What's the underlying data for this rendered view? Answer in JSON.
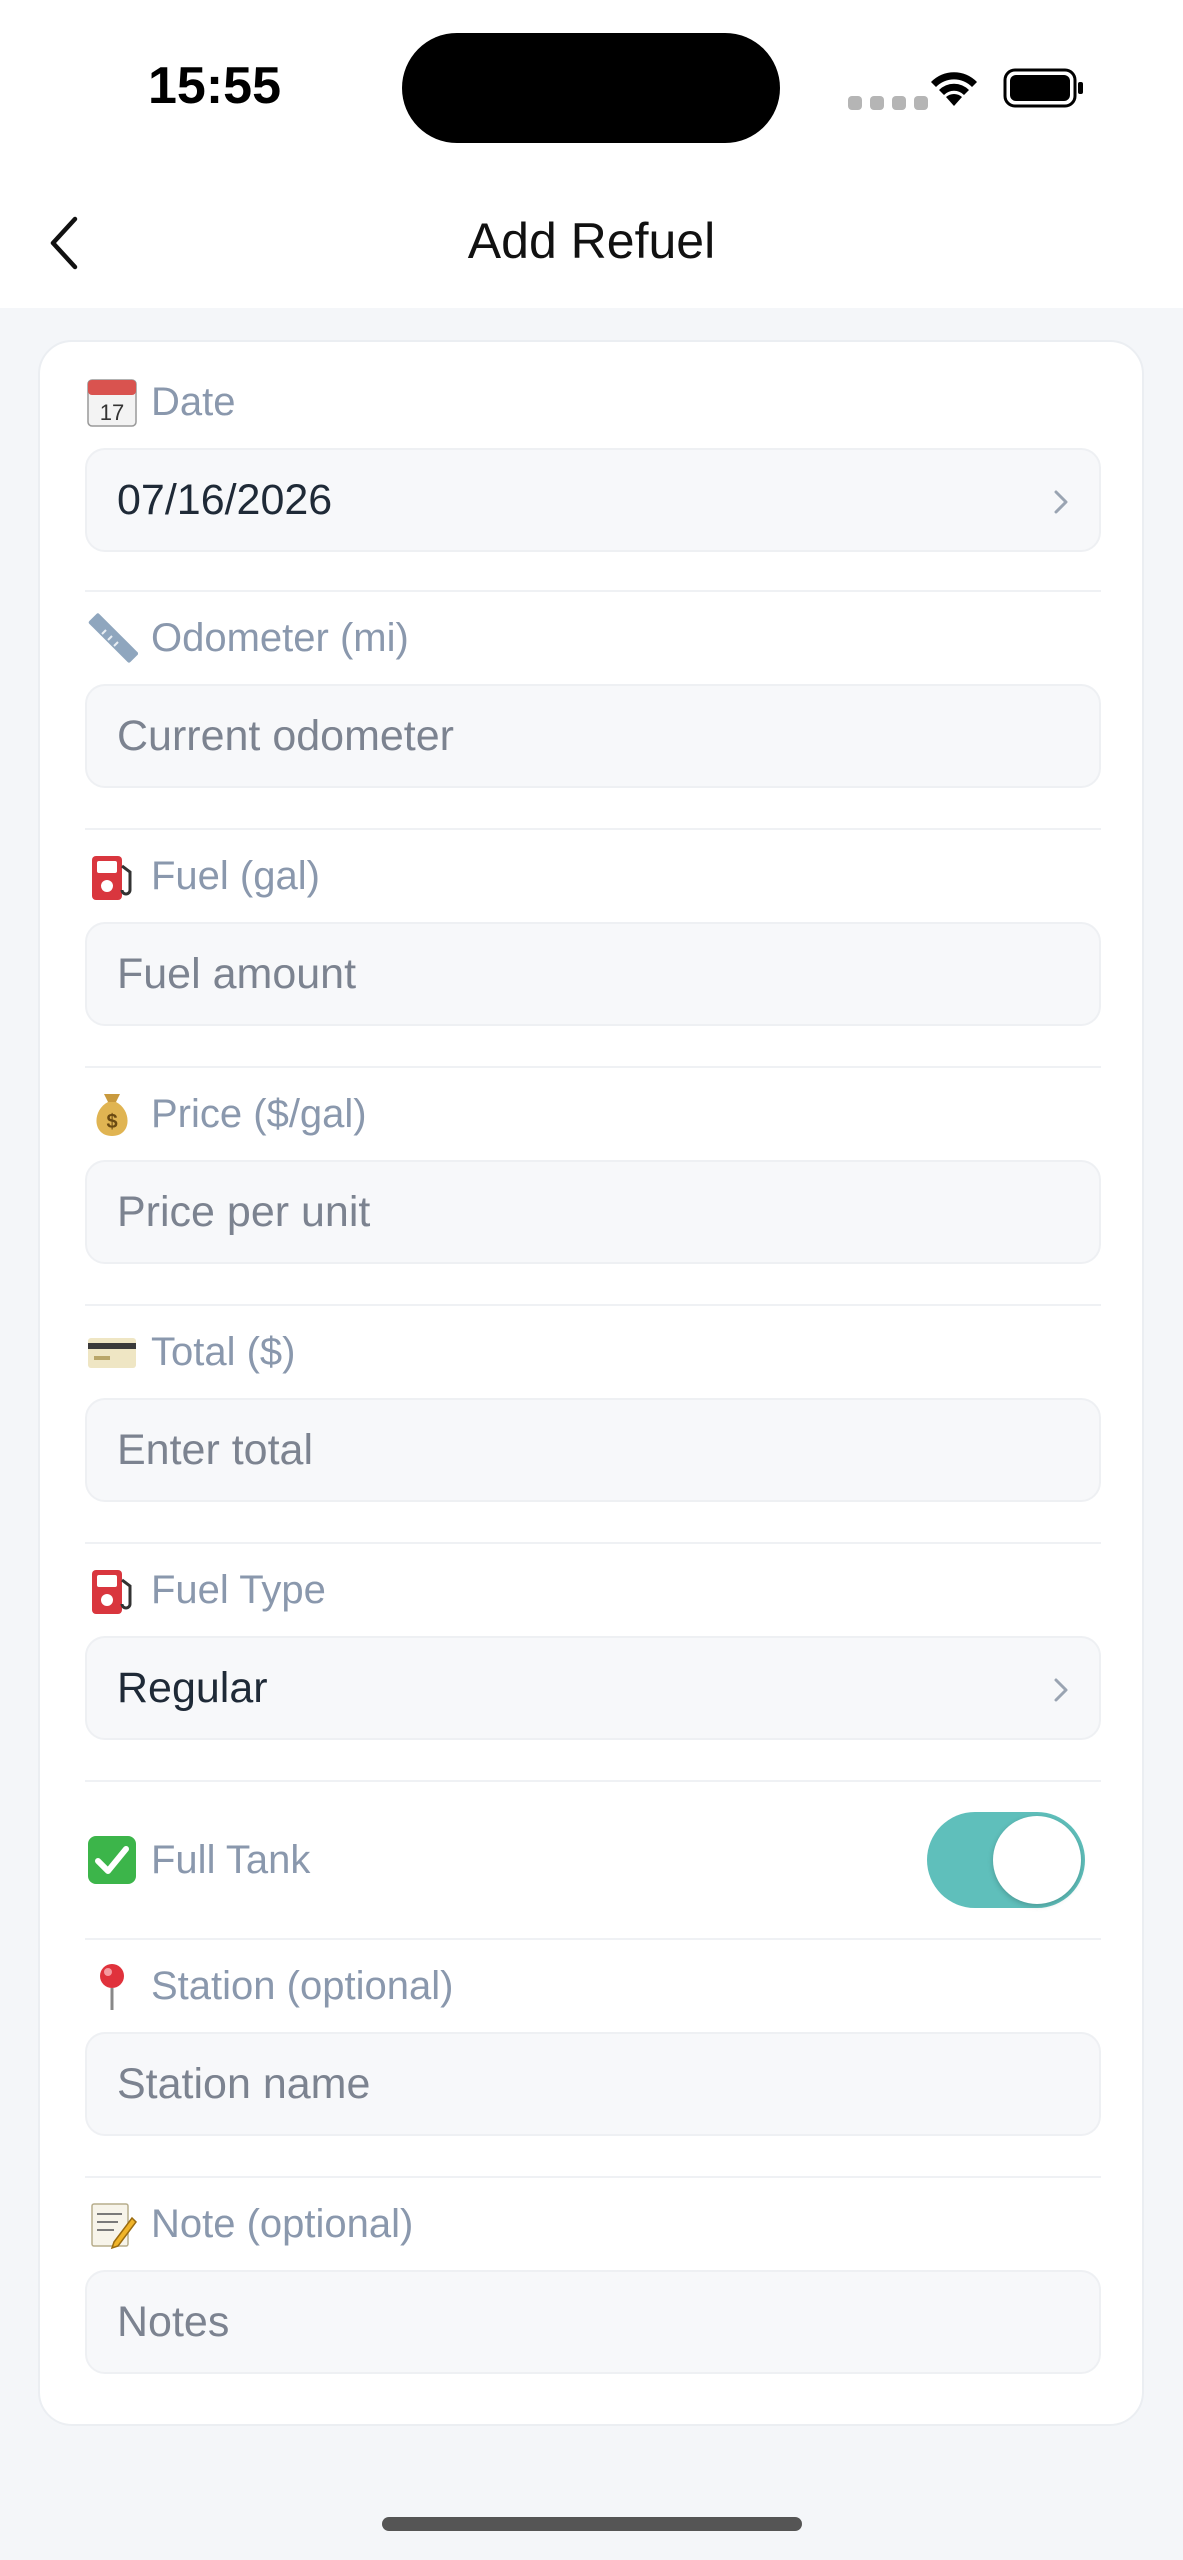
{
  "status_bar": {
    "time": "15:55"
  },
  "nav": {
    "title": "Add Refuel",
    "back_icon": "chevron-left-icon"
  },
  "fields": {
    "date": {
      "label": "Date",
      "icon": "calendar-icon",
      "value": "07/16/2026"
    },
    "odometer": {
      "label": "Odometer (mi)",
      "icon": "ruler-icon",
      "placeholder": "Current odometer"
    },
    "fuel": {
      "label": "Fuel (gal)",
      "icon": "fuel-pump-icon",
      "placeholder": "Fuel amount"
    },
    "price": {
      "label": "Price ($/gal)",
      "icon": "money-bag-icon",
      "placeholder": "Price per unit"
    },
    "total": {
      "label": "Total ($)",
      "icon": "credit-card-icon",
      "placeholder": "Enter total"
    },
    "fuel_type": {
      "label": "Fuel Type",
      "icon": "fuel-pump-icon",
      "value": "Regular"
    },
    "full_tank": {
      "label": "Full Tank",
      "icon": "check-box-icon",
      "enabled": true
    },
    "station": {
      "label": "Station (optional)",
      "icon": "pin-icon",
      "placeholder": "Station name"
    },
    "note": {
      "label": "Note (optional)",
      "icon": "memo-icon",
      "placeholder": "Notes"
    }
  },
  "colors": {
    "toggle_on": "#5fbfbb",
    "label": "#8a98ad",
    "background": "#f4f6f9"
  }
}
